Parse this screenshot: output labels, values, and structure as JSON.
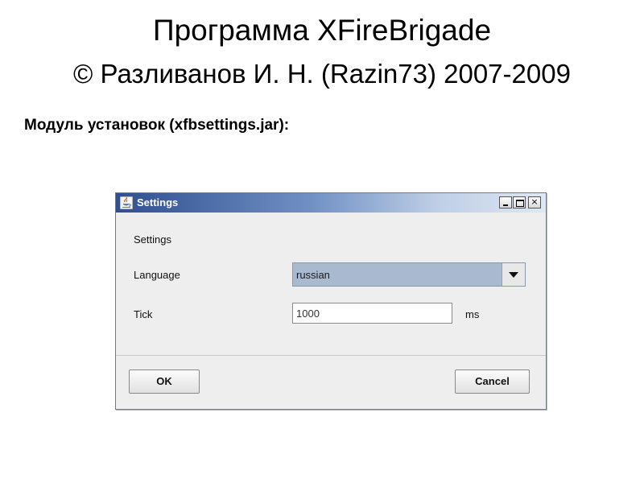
{
  "slide": {
    "title": "Программа XFireBrigade",
    "subtitle": "© Разливанов И. Н. (Razin73) 2007-2009",
    "section_heading": "Модуль установок (xfbsettings.jar):"
  },
  "window": {
    "title": "Settings",
    "icon": "java-cup-icon",
    "controls": {
      "minimize": "minimize-icon",
      "maximize": "maximize-icon",
      "close": "×"
    }
  },
  "form": {
    "section_label": "Settings",
    "language_label": "Language",
    "language_value": "russian",
    "tick_label": "Tick",
    "tick_value": "1000",
    "tick_unit": "ms"
  },
  "buttons": {
    "ok": "OK",
    "cancel": "Cancel"
  },
  "colors": {
    "titlebar_start": "#2f4f8f",
    "titlebar_end": "#dfe7f3",
    "combo_selected_bg": "#a9b9d0",
    "window_bg": "#eeeeee"
  }
}
